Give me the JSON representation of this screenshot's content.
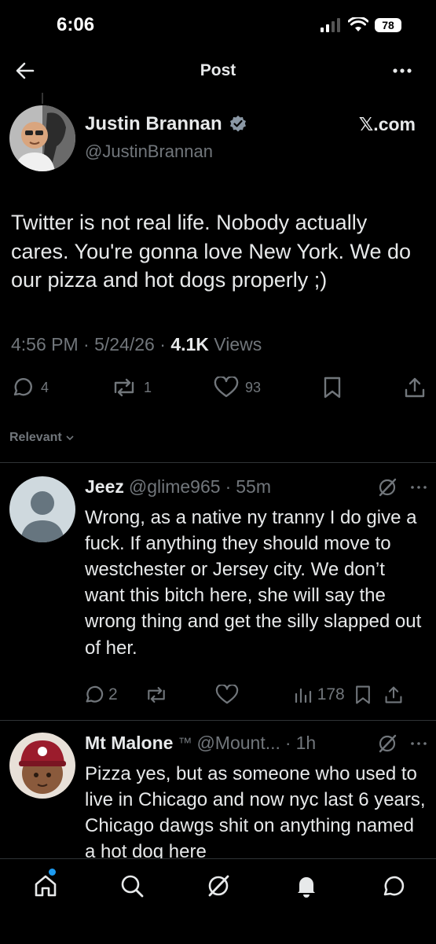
{
  "status_bar": {
    "time": "6:06",
    "battery": "78"
  },
  "header": {
    "title": "Post"
  },
  "post": {
    "author_name": "Justin Brannan",
    "author_handle": "@JustinBrannan",
    "source": "𝕏.com",
    "text": "Twitter is not real life. Nobody actually cares. You're gonna love New York. We do our pizza and hot dogs properly ;)",
    "time": "4:56 PM",
    "date": "5/24/26",
    "views_count": "4.1K",
    "views_label": "Views",
    "replies": "4",
    "reposts": "1",
    "likes": "93"
  },
  "sort_label": "Relevant",
  "replies": [
    {
      "name": "Jeez",
      "handle": "@glime965",
      "time": "55m",
      "text": "Wrong, as a native ny tranny I do give a fuck. If anything they should move to westchester or Jersey city. We don’t want this bitch here, she will say the wrong thing and get the silly slapped out of her.",
      "replies": "2",
      "views": "178"
    },
    {
      "name": "Mt Malone",
      "badge": "™",
      "handle": "@Mount...",
      "time": "1h",
      "text": "Pizza yes, but as someone who used to live in Chicago and now nyc last 6 years, Chicago dawgs shit on anything named a hot dog here"
    }
  ],
  "icons": {
    "back": "arrow-left-icon",
    "more": "ellipsis-icon",
    "verified": "verified-badge-icon",
    "reply": "speech-bubble-icon",
    "repost": "repost-icon",
    "like": "heart-icon",
    "bookmark": "bookmark-icon",
    "share": "share-icon",
    "grok": "grok-icon",
    "views": "bar-chart-icon",
    "home": "home-icon",
    "search": "search-icon",
    "notifications": "bell-icon",
    "messages": "chat-bubble-icon"
  },
  "colors": {
    "accent": "#1d9bf0",
    "background": "#000000",
    "muted": "#71767b"
  }
}
